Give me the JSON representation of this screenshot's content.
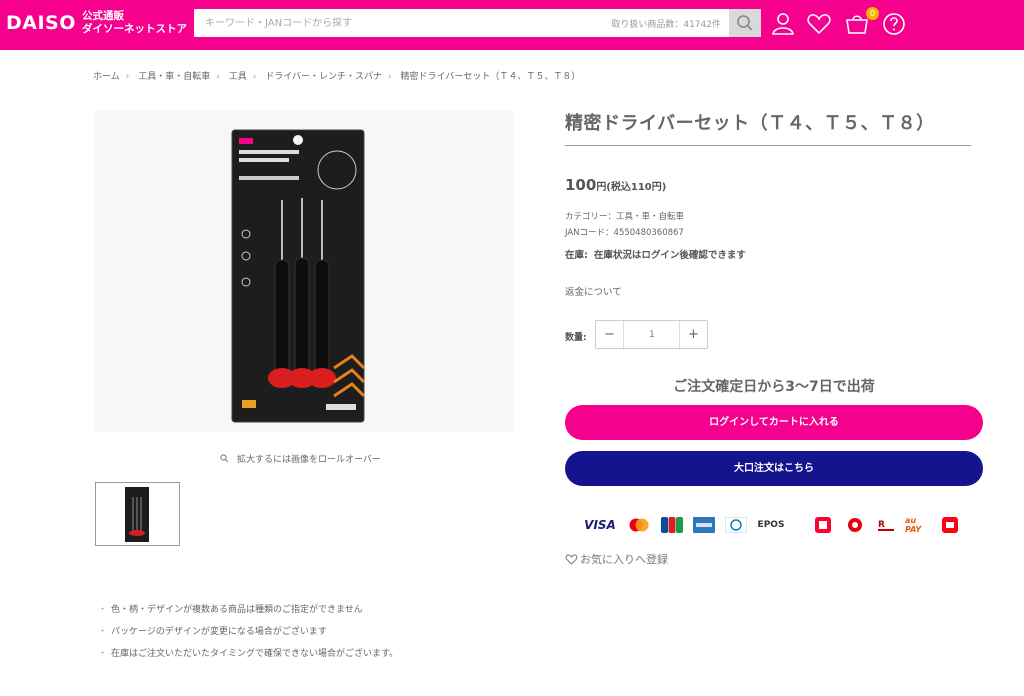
{
  "header": {
    "logo": "DAISO",
    "logo_sub_line1": "公式通販",
    "logo_sub_line2": "ダイソーネットストア",
    "search_placeholder": "キーワード・JANコードから探す",
    "search_count": "取り扱い商品数：41742件",
    "cart_count": "0"
  },
  "breadcrumb": [
    "ホーム",
    "工具・車・自転車",
    "工具",
    "ドライバー・レンチ・スパナ",
    "精密ドライバーセット（Ｔ４、Ｔ５、Ｔ８）"
  ],
  "gallery": {
    "zoom_hint": "拡大するには画像をロールオーバー"
  },
  "product": {
    "title": "精密ドライバーセット（Ｔ４、Ｔ５、Ｔ８）",
    "price": "100",
    "price_unit": "円(税込110円)",
    "category": "カテゴリー：工具・車・自転車",
    "jan": "JANコード：4550480360867",
    "stock_label": "在庫:",
    "stock_value": "在庫状況はログイン後確認できます",
    "refund_link": "返金について",
    "qty_label": "数量:",
    "qty_minus": "−",
    "qty_value": "1",
    "qty_plus": "+",
    "shipping": "ご注文確定日から3〜7日で出荷",
    "login_cart_button": "ログインしてカートに入れる",
    "bulk_order_button": "大口注文はこちら",
    "favorite": "お気に入りへ登録"
  },
  "payments": [
    "VISA",
    "mastercard",
    "JCB",
    "AMEX",
    "Diners",
    "EPOS",
    "PayPay",
    "d払い",
    "楽天Pay",
    "au PAY",
    "メルペイ"
  ],
  "notes": [
    "色・柄・デザインが複数ある商品は種類のご指定ができません",
    "パッケージのデザインが変更になる場合がございます",
    "在庫はご注文いただいたタイミングで確保できない場合がございます。"
  ],
  "colors": {
    "brand": "#f5018e",
    "bulk": "#13148e"
  }
}
